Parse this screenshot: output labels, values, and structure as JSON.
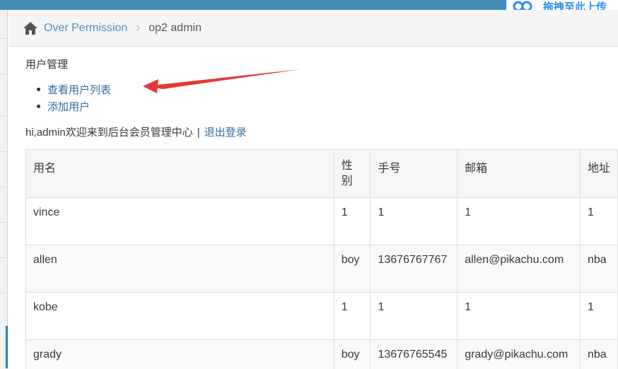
{
  "upload": {
    "label": "拖拽至此上传"
  },
  "breadcrumb": {
    "home": "Over Permission",
    "current": "op2 admin"
  },
  "section": {
    "title": "用户管理"
  },
  "menu": [
    {
      "label": "查看用户列表"
    },
    {
      "label": "添加用户"
    }
  ],
  "welcome": {
    "text": "hi,admin欢迎来到后台会员管理中心",
    "separator": "|",
    "logout": "退出登录"
  },
  "table": {
    "headers": [
      "用名",
      "性别",
      "手号",
      "邮箱",
      "地址"
    ],
    "rows": [
      [
        "vince",
        "1",
        "1",
        "1",
        "1"
      ],
      [
        "allen",
        "boy",
        "13676767767",
        "allen@pikachu.com",
        "nba"
      ],
      [
        "kobe",
        "1",
        "1",
        "1",
        "1"
      ],
      [
        "grady",
        "boy",
        "13676765545",
        "grady@pikachu.com",
        "nba"
      ]
    ]
  },
  "colors": {
    "topbar": "#438eb9",
    "link": "#2e6da4",
    "arrow": "#e53935",
    "upload": "#2d8cf0"
  }
}
